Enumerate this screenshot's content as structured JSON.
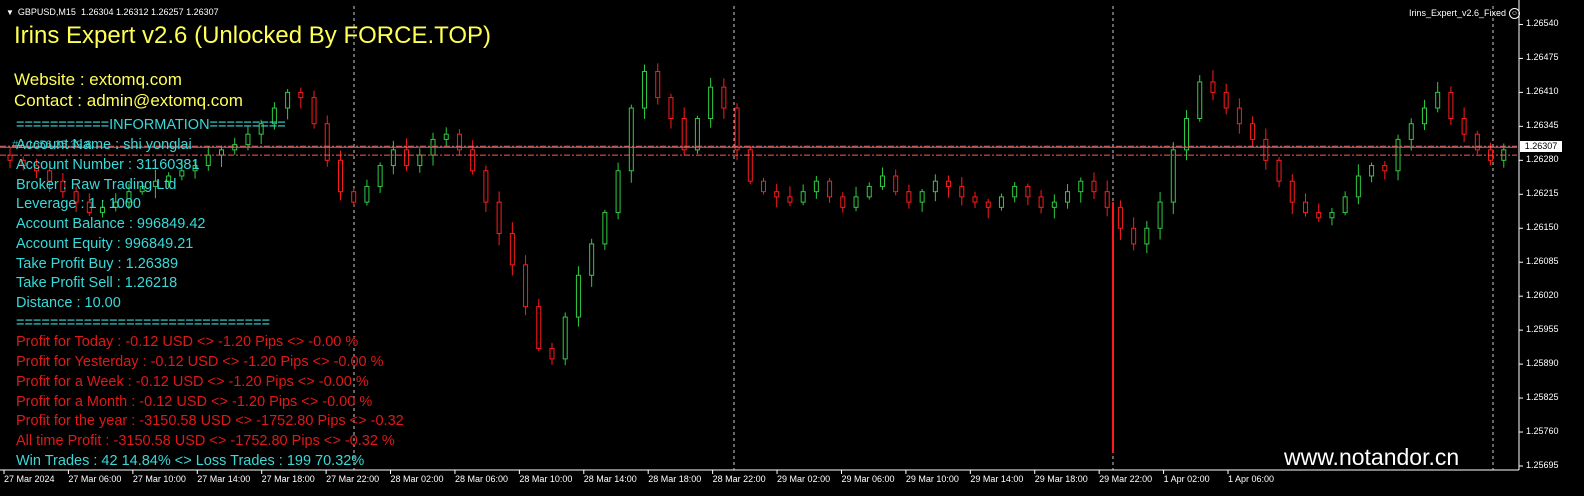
{
  "symbol": {
    "pair": "GBPUSD,M15",
    "ohlc": "1.26304 1.26312 1.26257 1.26307"
  },
  "ea_name": "Irins_Expert_v2.6_Fixed",
  "title": "Irins Expert v2.6 (Unlocked By FORCE.TOP)",
  "website": "Website : extomq.com",
  "contact": "Contact : admin@extomq.com",
  "separator_top": "===========INFORMATION=========",
  "overlap_text": "#2.1656.35.39.8",
  "info": {
    "account_name": "Account Name    :  shi yonglai",
    "account_number": "Account Number :  31160381",
    "broker": "Broker            :  Raw Trading Ltd",
    "leverage": "Leverage          :  1 : 1000",
    "balance": "Account Balance  :  996849.42",
    "equity": "Account Equity    :  996849.21",
    "tp_buy": "Take Profit Buy    :  1.26389",
    "tp_sell": "Take Profit Sell    :  1.26218",
    "distance": "Distance     :  10.00"
  },
  "separator_bottom": "==============================",
  "profit": {
    "today": "Profit for Today  :  -0.12 USD <> -1.20 Pips <> -0.00 %",
    "yesterday": "Profit for Yesterday  :  -0.12 USD <> -1.20 Pips <> -0.00 %",
    "week": "Profit for a Week :  -0.12 USD <> -1.20 Pips <> -0.00 %",
    "month": "Profit for a Month :  -0.12 USD <> -1.20 Pips <> -0.00 %",
    "year": "Profit for the year :  -3150.58 USD <> -1752.80 Pips <> -0.32",
    "all_time": "All time Profit :  -3150.58 USD <> -1752.80 Pips <> -0.32 %"
  },
  "trades": "Win Trades :  42 14.84% <> Loss Trades :  199 70.32%",
  "watermark": "www.notandor.cn",
  "price_scale": {
    "labels": [
      "1.26540",
      "1.26475",
      "1.26410",
      "1.26345",
      "1.26280",
      "1.26215",
      "1.26150",
      "1.26085",
      "1.26020",
      "1.25955",
      "1.25890",
      "1.25825",
      "1.25760",
      "1.25695"
    ],
    "current": "1.26307"
  },
  "time_axis": [
    "27 Mar 2024",
    "27 Mar 06:00",
    "27 Mar 10:00",
    "27 Mar 14:00",
    "27 Mar 18:00",
    "27 Mar 22:00",
    "28 Mar 02:00",
    "28 Mar 06:00",
    "28 Mar 10:00",
    "28 Mar 14:00",
    "28 Mar 18:00",
    "28 Mar 22:00",
    "29 Mar 02:00",
    "29 Mar 06:00",
    "29 Mar 10:00",
    "29 Mar 14:00",
    "29 Mar 18:00",
    "29 Mar 22:00",
    "1 Apr 02:00",
    "1 Apr 06:00"
  ],
  "colors": {
    "bull": "#2ecc40",
    "bear": "#ff1a1a",
    "title": "#ffff55",
    "info": "#38d9d9",
    "profit": "#e01818",
    "grid_dash": "#ffffff"
  },
  "chart_data": {
    "type": "candlestick",
    "ylim": [
      1.25695,
      1.2656
    ],
    "levels": {
      "tp_buy": 1.26389,
      "current": 1.26307,
      "tp_sell": 1.2629
    },
    "closes": [
      1.2628,
      1.2627,
      1.2626,
      1.2624,
      1.2622,
      1.262,
      1.2618,
      1.2619,
      1.262,
      1.2622,
      1.2623,
      1.2624,
      1.2625,
      1.2626,
      1.2627,
      1.2629,
      1.263,
      1.2631,
      1.2633,
      1.2635,
      1.2638,
      1.2641,
      1.264,
      1.2635,
      1.2628,
      1.2622,
      1.262,
      1.2623,
      1.2627,
      1.263,
      1.2627,
      1.2629,
      1.2632,
      1.2633,
      1.263,
      1.2626,
      1.262,
      1.2614,
      1.2608,
      1.26,
      1.2592,
      1.259,
      1.2598,
      1.2606,
      1.2612,
      1.2618,
      1.2626,
      1.2638,
      1.2645,
      1.264,
      1.2636,
      1.263,
      1.2636,
      1.2642,
      1.2638,
      1.263,
      1.2624,
      1.2622,
      1.2621,
      1.262,
      1.2622,
      1.2624,
      1.2621,
      1.2619,
      1.2621,
      1.2623,
      1.2625,
      1.2622,
      1.262,
      1.2622,
      1.2624,
      1.2623,
      1.2621,
      1.262,
      1.2619,
      1.2621,
      1.2623,
      1.2621,
      1.2619,
      1.262,
      1.2622,
      1.2624,
      1.2622,
      1.2619,
      1.2615,
      1.2612,
      1.2615,
      1.262,
      1.263,
      1.2636,
      1.2643,
      1.2641,
      1.2638,
      1.2635,
      1.2632,
      1.2628,
      1.2624,
      1.262,
      1.2618,
      1.2617,
      1.2618,
      1.2621,
      1.2625,
      1.2627,
      1.2626,
      1.2632,
      1.2635,
      1.2638,
      1.2641,
      1.2636,
      1.2633,
      1.263,
      1.2628,
      1.263
    ]
  }
}
